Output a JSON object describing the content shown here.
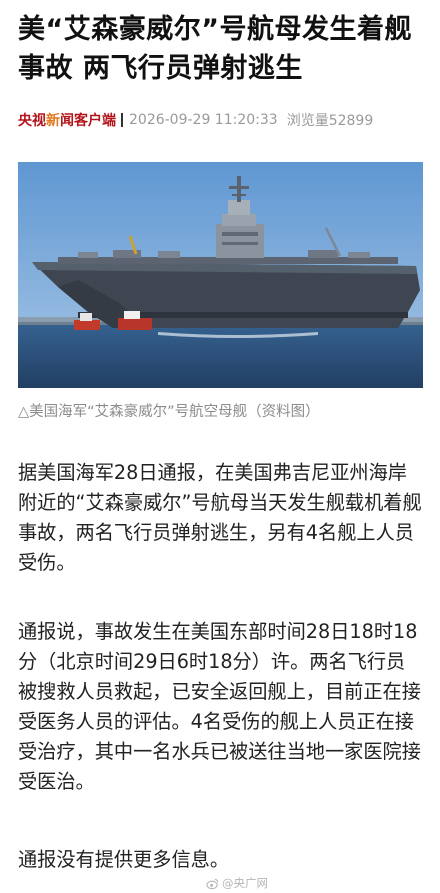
{
  "article": {
    "headline": "美“艾森豪威尔”号航母发生着舰事故 两飞行员弹射逃生",
    "source": {
      "name_part1": "央视",
      "name_highlight": "新",
      "name_part2": "闻客户端"
    },
    "datetime": "2026-09-29 11:20:33",
    "views": "浏览量52899",
    "photo": {
      "semantic": "aircraft-carrier-photo"
    },
    "caption": "△美国海军“艾森豪威尔”号航空母舰（资料图）",
    "paragraphs": [
      "据美国海军28日通报，在美国弗吉尼亚州海岸附近的“艾森豪威尔”号航母当天发生舰载机着舰事故，两名飞行员弹射逃生，另有4名舰上人员受伤。",
      "通报说，事故发生在美国东部时间28日18时18分（北京时间29日6时18分）许。两名飞行员被搜救人员救起，已安全返回舰上，目前正在接受医务人员的评估。4名受伤的舰上人员正在接受治疗，其中一名水兵已被送往当地一家医院接受医治。",
      "通报没有提供更多信息。"
    ],
    "watermark": "@央广网",
    "watermark_icon": "weibo-icon"
  },
  "colors": {
    "brand_red": "#b3141b",
    "brand_orange": "#e07a1f",
    "meta_gray": "#9a9a9a",
    "sky": "#6fa2d6",
    "water": "#2d5a8a",
    "hull": "#3f4652"
  }
}
